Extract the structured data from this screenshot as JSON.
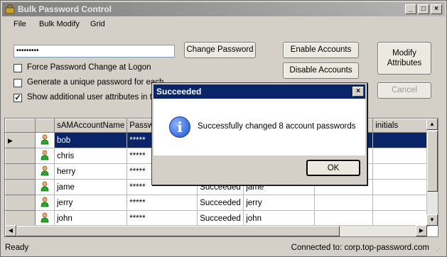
{
  "window": {
    "title": "Bulk Password Control"
  },
  "menu": [
    "File",
    "Bulk Modify",
    "Grid"
  ],
  "password": {
    "value": "•••••••••"
  },
  "buttons": {
    "change_password": "Change Password",
    "enable_accounts": "Enable Accounts",
    "disable_accounts": "Disable Accounts",
    "modify_attributes_line1": "Modify",
    "modify_attributes_line2": "Attributes",
    "cancel": "Cancel"
  },
  "options": {
    "force_change": {
      "label": "Force Password Change at Logon",
      "checked": false
    },
    "unique_password": {
      "label": "Generate a unique password for each",
      "checked": false
    },
    "show_attributes": {
      "label": "Show additional user attributes in th",
      "checked": true
    }
  },
  "grid": {
    "columns": [
      "sAMAccountName",
      "Passw",
      "",
      "",
      "",
      "initials"
    ],
    "rows": [
      {
        "name": "bob",
        "password": "*****",
        "status": "",
        "account": "",
        "selected": true
      },
      {
        "name": "chris",
        "password": "*****",
        "status": "",
        "account": ""
      },
      {
        "name": "herry",
        "password": "*****",
        "status": "",
        "account": ""
      },
      {
        "name": "jame",
        "password": "*****",
        "status": "Succeeded",
        "account": "jame"
      },
      {
        "name": "jerry",
        "password": "*****",
        "status": "Succeeded",
        "account": "jerry"
      },
      {
        "name": "john",
        "password": "*****",
        "status": "Succeeded",
        "account": "john"
      }
    ]
  },
  "status": {
    "left": "Ready",
    "right": "Connected to: corp.top-password.com"
  },
  "dialog": {
    "title": "Succeeded",
    "message": "Successfully changed 8 account passwords",
    "ok": "OK"
  },
  "colors": {
    "selection": "#0a246a",
    "dialog_title": "#0a246a",
    "window_bg": "#d4d0c8"
  }
}
